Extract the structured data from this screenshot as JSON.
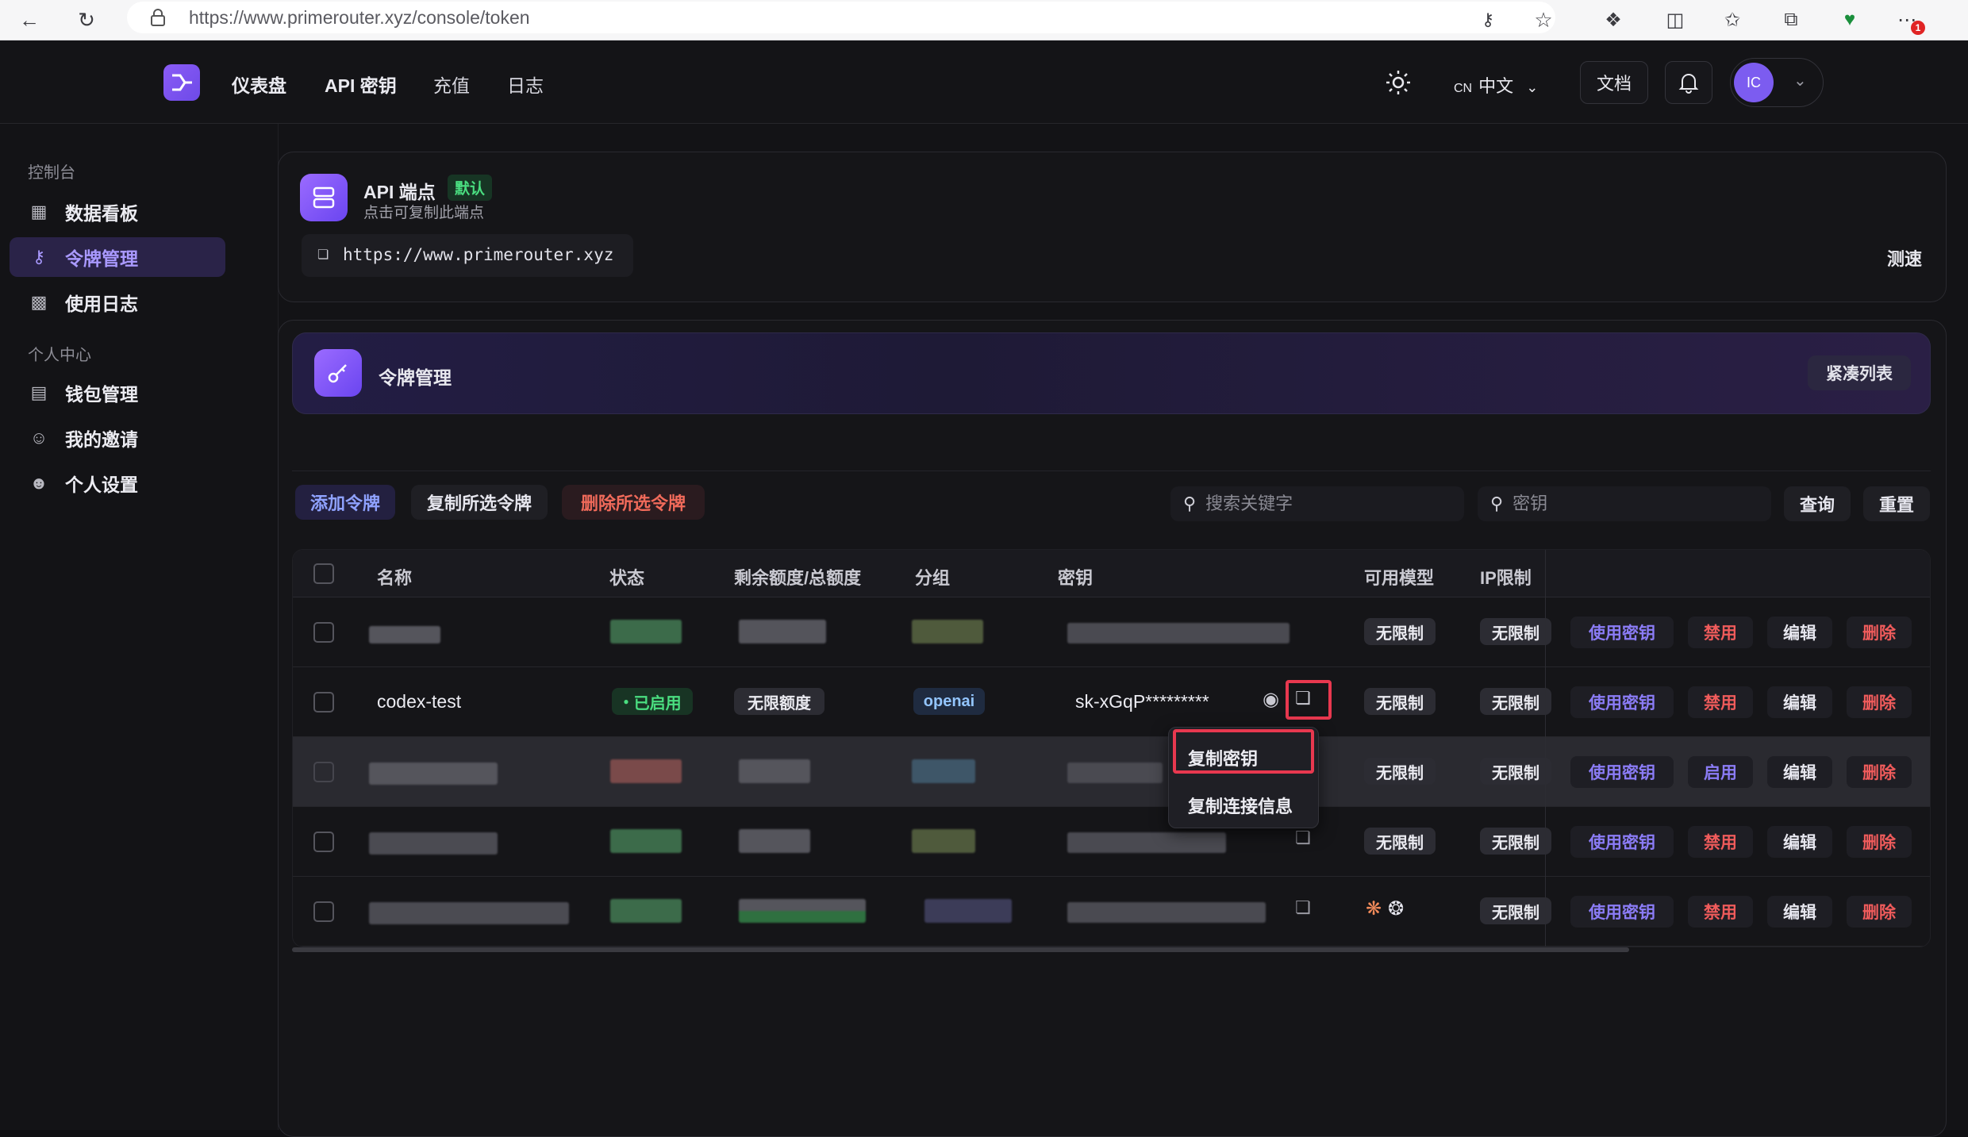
{
  "browser": {
    "url": "https://www.primerouter.xyz/console/token",
    "notification_count": "1"
  },
  "header": {
    "nav": [
      "仪表盘",
      "API 密钥",
      "充值",
      "日志"
    ],
    "lang_code": "CN",
    "lang_label": "中文",
    "docs_label": "文档",
    "avatar_initials": "IC"
  },
  "sidebar": {
    "section_console": "控制台",
    "section_personal": "个人中心",
    "items": [
      {
        "label": "数据看板",
        "icon": "grid-icon"
      },
      {
        "label": "令牌管理",
        "icon": "key-icon",
        "active": true
      },
      {
        "label": "使用日志",
        "icon": "bar-chart-icon"
      },
      {
        "label": "钱包管理",
        "icon": "wallet-icon"
      },
      {
        "label": "我的邀请",
        "icon": "users-icon"
      },
      {
        "label": "个人设置",
        "icon": "user-icon"
      }
    ]
  },
  "api_card": {
    "title": "API 端点",
    "badge": "默认",
    "subtitle": "点击可复制此端点",
    "endpoint": "https://www.primerouter.xyz",
    "speed_test": "测速"
  },
  "token_panel": {
    "title": "令牌管理",
    "compact_toggle": "紧凑列表",
    "add_button": "添加令牌",
    "copy_selected": "复制所选令牌",
    "delete_selected": "删除所选令牌",
    "search_keyword_placeholder": "搜索关键字",
    "search_key_placeholder": "密钥",
    "query_button": "查询",
    "reset_button": "重置"
  },
  "table": {
    "columns": [
      "名称",
      "状态",
      "剩余额度/总额度",
      "分组",
      "密钥",
      "可用模型",
      "IP限制"
    ],
    "rows": [
      {
        "name": "",
        "status": "",
        "quota": "",
        "group": "",
        "key": "",
        "models": "无限制",
        "ip": "无限制",
        "actions": [
          "使用密钥",
          "禁用",
          "编辑",
          "删除"
        ]
      },
      {
        "name": "codex-test",
        "status": "已启用",
        "quota": "无限额度",
        "group": "openai",
        "key": "sk-xGqP*********",
        "models": "无限制",
        "ip": "无限制",
        "actions": [
          "使用密钥",
          "禁用",
          "编辑",
          "删除"
        ]
      },
      {
        "name": "",
        "status": "",
        "quota": "",
        "group": "",
        "key": "",
        "models": "无限制",
        "ip": "无限制",
        "actions": [
          "使用密钥",
          "启用",
          "编辑",
          "删除"
        ]
      },
      {
        "name": "",
        "status": "",
        "quota": "",
        "group": "",
        "key": "",
        "models": "无限制",
        "ip": "无限制",
        "actions": [
          "使用密钥",
          "禁用",
          "编辑",
          "删除"
        ]
      },
      {
        "name": "",
        "status": "",
        "quota": "",
        "group": "",
        "key": "",
        "models": "",
        "ip": "无限制",
        "actions": [
          "使用密钥",
          "禁用",
          "编辑",
          "删除"
        ]
      }
    ]
  },
  "copy_menu": {
    "items": [
      "复制密钥",
      "复制连接信息"
    ]
  },
  "colors": {
    "accent": "#8b5cf6",
    "danger": "#ef5b5b",
    "success": "#4ade80",
    "highlight_box": "#e8384f"
  }
}
